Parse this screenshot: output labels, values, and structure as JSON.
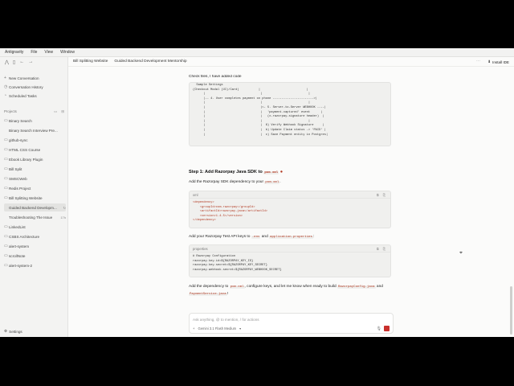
{
  "menubar": {
    "items": [
      "Antigravity",
      "File",
      "View",
      "Window"
    ]
  },
  "sidebar": {
    "new_conversation": "New Conversation",
    "conversation_history": "Conversation History",
    "scheduled_tasks": "Scheduled Tasks",
    "projects_label": "Projects",
    "projects": [
      {
        "label": "Binary Search",
        "type": "project"
      },
      {
        "label": "Binary Search Interview Pre...",
        "type": "sub"
      },
      {
        "label": "github-sync",
        "type": "project"
      },
      {
        "label": "HTML CSS Course",
        "type": "project"
      },
      {
        "label": "Ebook Library Plugin",
        "type": "project"
      },
      {
        "label": "Bill Split",
        "type": "project"
      },
      {
        "label": "SMSCWeb",
        "type": "project"
      },
      {
        "label": "Redis Project",
        "type": "project"
      },
      {
        "label": "Bill Splitting Website",
        "type": "project"
      },
      {
        "label": "Guided Backend Developm...",
        "type": "sub",
        "active": true
      },
      {
        "label": "Troubleshooting The Issue",
        "type": "sub",
        "meta": "17h"
      },
      {
        "label": "LinkedList",
        "type": "project"
      },
      {
        "label": "CSBS Architecture",
        "type": "project"
      },
      {
        "label": "alert-system",
        "type": "project"
      },
      {
        "label": "scrollNote",
        "type": "project"
      },
      {
        "label": "alert-system-2",
        "type": "project"
      }
    ],
    "settings": "Settings"
  },
  "topbar": {
    "crumbs": [
      "Bill Splitting Website",
      "Guided Backend Development Mentorship"
    ],
    "install": "Install IDE"
  },
  "chat": {
    "user_msg": "Check files, I have added code",
    "diagram_code": "  Sample Settings\n(Checkout Modal (UI)/Card)           |                          |\n      |                               |                          |\n      |-- 4. User completes payment on phone ----------------------->|\n      |                               |                          |\n      |                               |<- 5. Server-to-Server WEBHOOK ----|\n      |                               |   'payment.captured' event      |\n      |                               |   (x-razorpay-signature header)  |\n      |                               |                          |\n      |                               |  6) Verify Webhook Signature     |\n      |                               |  b) Update Claim status -> 'PAID' |\n      |                               |  c) Save Payment entity in Postgres|",
    "step1_title": "Step 1: Add Razorpay Java SDK to",
    "step1_file": "pom.xml",
    "step1_desc_a": "Add the Razorpay SDK dependency to your",
    "step1_desc_file": "pom.xml",
    "xml_lang": "xml",
    "xml_lines": [
      "<dependency>",
      "    <groupId>com.razorpay</groupId>",
      "    <artifactId>razorpay-java</artifactId>",
      "    <version>1.4.5</version>",
      "</dependency>"
    ],
    "keys_desc_a": "Add your Razorpay Test API keys to",
    "keys_env": ".env",
    "keys_and": "and",
    "keys_props": "application.properties",
    "props_lang": "properties",
    "props_lines": [
      "# Razorpay Configuration",
      "razorpay.key.id=${RAZORPAY_KEY_ID}",
      "razorpay.key.secret=${RAZORPAY_KEY_SECRET}",
      "razorpay.webhook.secret=${RAZORPAY_WEBHOOK_SECRET}"
    ],
    "final_a": "Add the dependency to",
    "final_pom": "pom.xml",
    "final_b": ", configure keys, and let me know when ready to build",
    "final_cfg": "RazorpayConfig.java",
    "final_and": "and",
    "final_svc": "PaymentService.java",
    "final_end": "!"
  },
  "input": {
    "placeholder": "Ask anything, @ to mention, / for actions",
    "model": "Gemini 3.1 Flash Medium"
  },
  "colors": {
    "accent": "#c9302c",
    "code_tag": "#b1361e"
  }
}
